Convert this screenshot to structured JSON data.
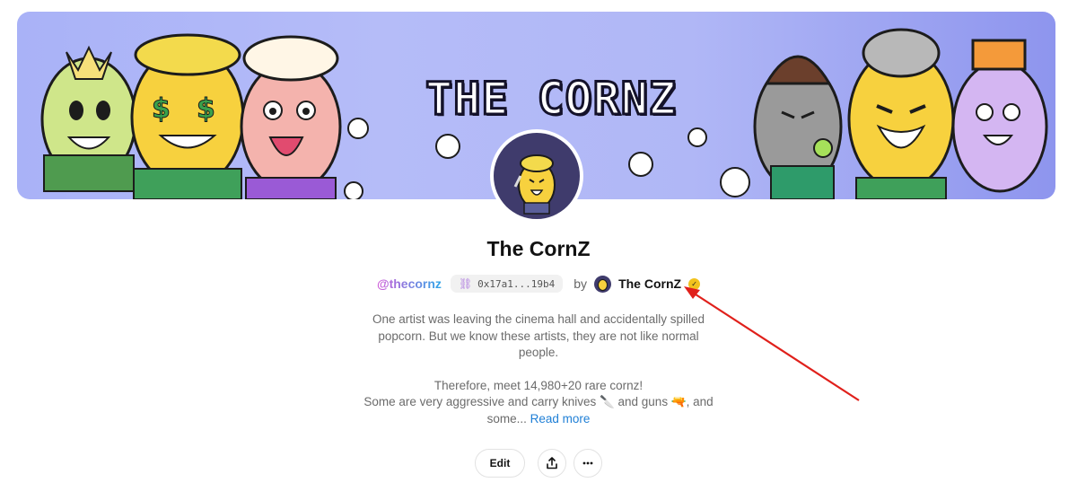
{
  "banner": {
    "title": "THE CORNZ"
  },
  "collection": {
    "name": "The CornZ",
    "handle": "@thecornz",
    "address": "0x17a1...19b4",
    "by_label": "by",
    "creator_name": "The CornZ",
    "description_lines": [
      "One artist was leaving the cinema hall and accidentally spilled",
      "popcorn. But we know these artists, they are not like normal",
      "people.",
      "Therefore, meet 14,980+20 rare cornz!",
      "Some are very aggressive and carry knives 🔪 and guns 🔫, and",
      "some..."
    ],
    "read_more": "Read more"
  },
  "actions": {
    "edit_label": "Edit",
    "share_icon": "share-icon",
    "more_icon": "more-icon"
  },
  "colors": {
    "accent_link": "#1f7fd6",
    "verified": "#f2c21d",
    "annotation_arrow": "#e0201b"
  }
}
